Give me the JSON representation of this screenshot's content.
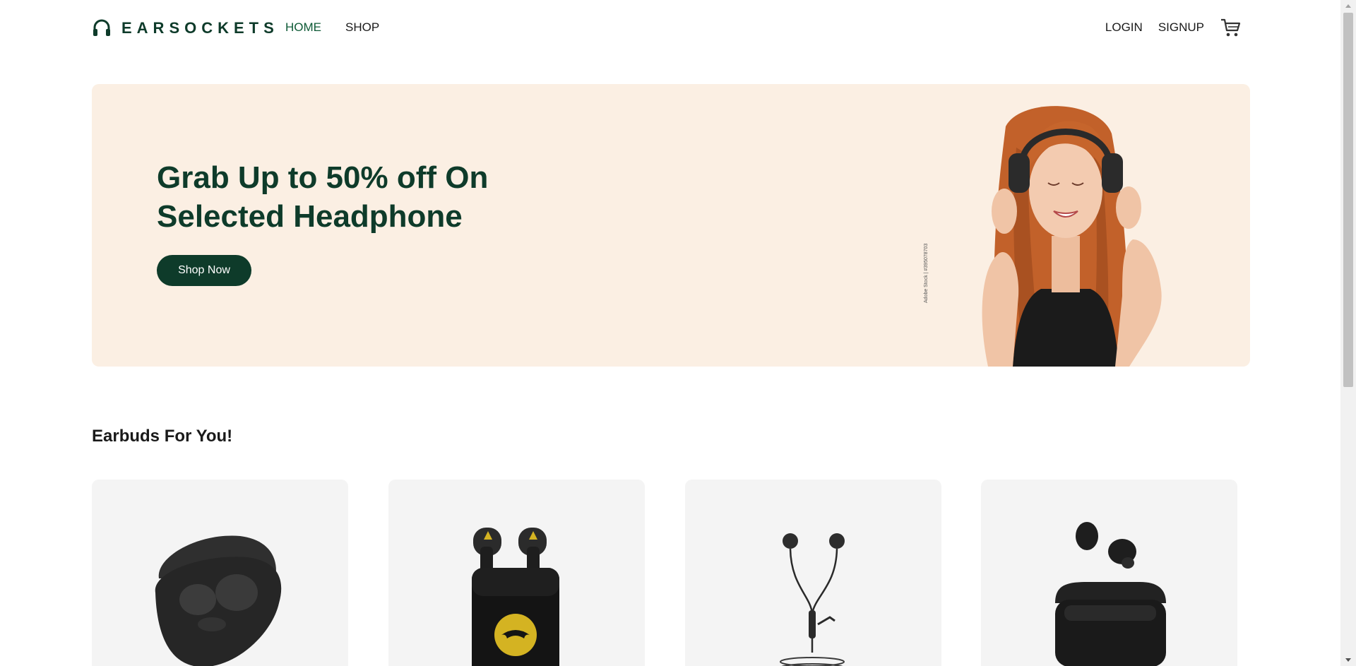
{
  "header": {
    "brand": "EARSOCKETS",
    "nav": [
      {
        "label": "HOME",
        "active": true
      },
      {
        "label": "SHOP",
        "active": false
      }
    ],
    "login_label": "LOGIN",
    "signup_label": "SIGNUP",
    "cart_icon": "cart-icon"
  },
  "hero": {
    "title_line1": "Grab Up to 50% off On",
    "title_line2": "Selected Headphone",
    "button_label": "Shop Now",
    "image_credit": "Adobe Stock | #395078703"
  },
  "section": {
    "title": "Earbuds For You!"
  },
  "products": [
    {
      "icon": "jabra-earbuds-case-image"
    },
    {
      "icon": "batman-earbuds-case-image"
    },
    {
      "icon": "wired-earphones-image"
    },
    {
      "icon": "black-earbuds-open-case-image"
    }
  ],
  "colors": {
    "brand_dark": "#0e3b2a",
    "nav_active": "#0e5a36",
    "hero_bg": "#fbefe3",
    "card_bg": "#f4f4f4"
  }
}
